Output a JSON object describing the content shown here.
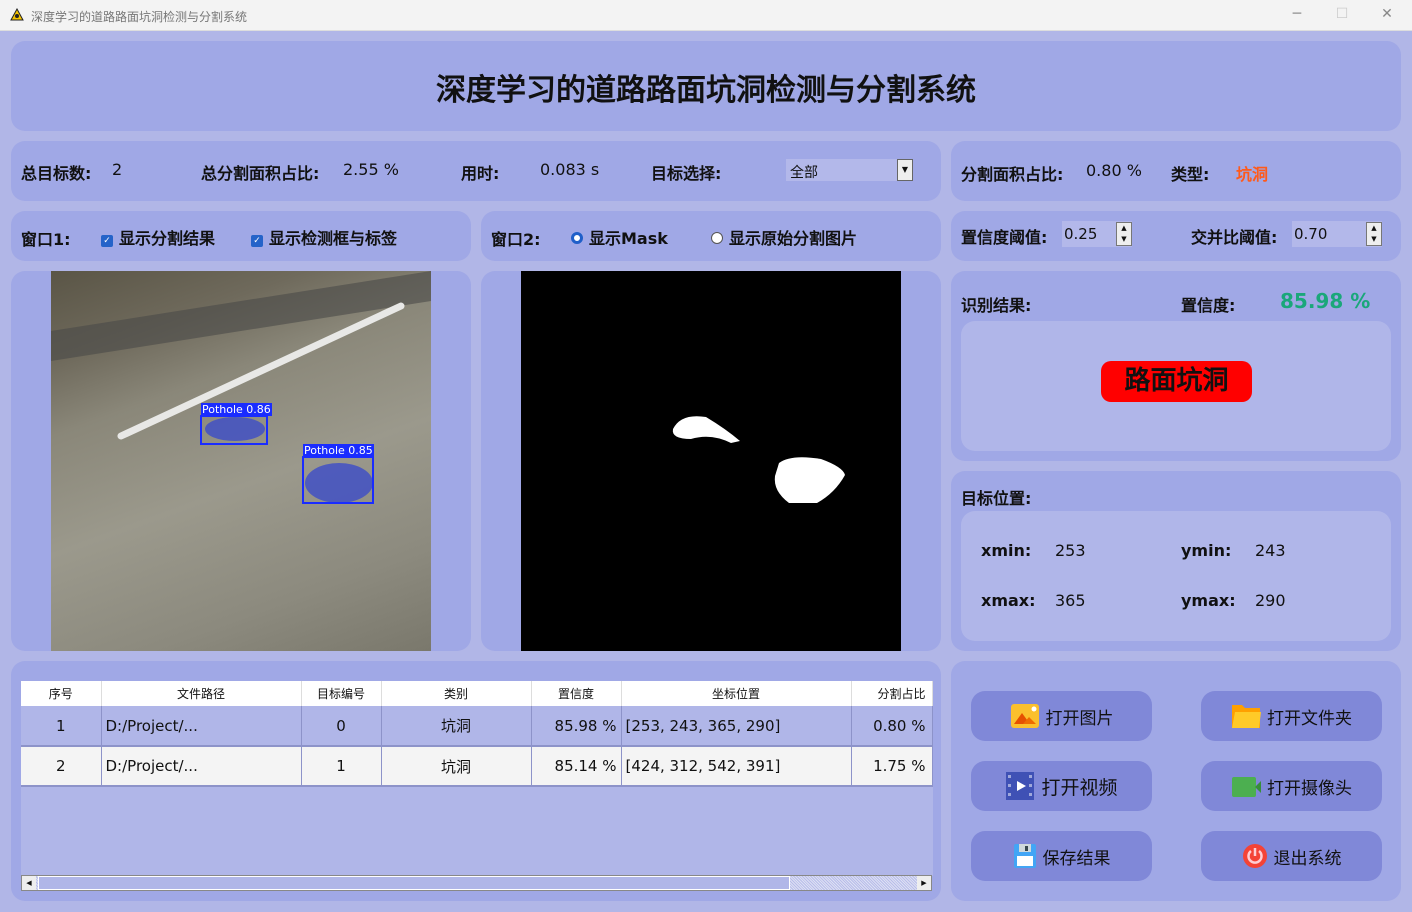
{
  "window": {
    "title": "深度学习的道路路面坑洞检测与分割系统",
    "minimize": "─",
    "maximize": "☐",
    "close": "✕"
  },
  "header": {
    "title": "深度学习的道路路面坑洞检测与分割系统"
  },
  "stats": {
    "total_label": "总目标数:",
    "total_value": "2",
    "area_label": "总分割面积占比:",
    "area_value": "2.55 %",
    "time_label": "用时:",
    "time_value": "0.083 s",
    "select_label": "目标选择:",
    "select_value": "全部"
  },
  "window1": {
    "label": "窗口1:",
    "opt1": "显示分割结果",
    "opt2": "显示检测框与标签"
  },
  "window2": {
    "label": "窗口2:",
    "opt1": "显示Mask",
    "opt2": "显示原始分割图片"
  },
  "detail": {
    "seg_label": "分割面积占比:",
    "seg_value": "0.80 %",
    "type_label": "类型:",
    "type_value": "坑洞",
    "type_color": "#ff5a1a"
  },
  "thresholds": {
    "conf_label": "置信度阈值:",
    "conf_value": "0.25",
    "iou_label": "交并比阈值:",
    "iou_value": "0.70"
  },
  "result": {
    "label": "识别结果:",
    "conf_label": "置信度:",
    "conf_value": "85.98 %",
    "class_badge": "路面坑洞",
    "badge_color": "#ff0000",
    "conf_color": "#1aa77a"
  },
  "position": {
    "label": "目标位置:",
    "xmin_label": "xmin:",
    "xmin": "253",
    "ymin_label": "ymin:",
    "ymin": "243",
    "xmax_label": "xmax:",
    "xmax": "365",
    "ymax_label": "ymax:",
    "ymax": "290"
  },
  "detections": [
    {
      "label": "Pothole  0.86"
    },
    {
      "label": "Pothole  0.85"
    }
  ],
  "table": {
    "headers": [
      "序号",
      "文件路径",
      "目标编号",
      "类别",
      "置信度",
      "坐标位置",
      "分割占比"
    ],
    "rows": [
      [
        "1",
        "D:/Project/...",
        "0",
        "坑洞",
        "85.98 %",
        "[253, 243, 365, 290]",
        "0.80 %"
      ],
      [
        "2",
        "D:/Project/...",
        "1",
        "坑洞",
        "85.14 %",
        "[424, 312, 542, 391]",
        "1.75 %"
      ]
    ]
  },
  "buttons": {
    "open_image": "打开图片",
    "open_folder": "打开文件夹",
    "open_video": "打开视频",
    "open_camera": "打开摄像头",
    "save": "保存结果",
    "exit": "退出系统"
  }
}
